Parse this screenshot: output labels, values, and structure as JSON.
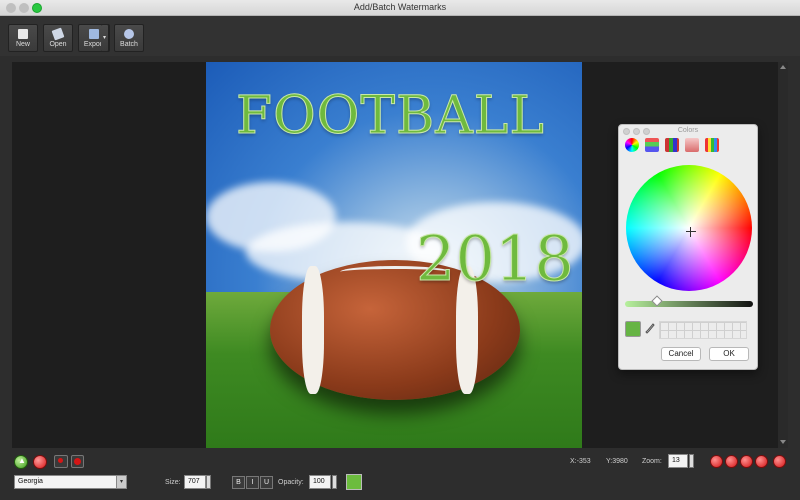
{
  "window": {
    "title": "Add/Batch Watermarks"
  },
  "toolbar": {
    "new_label": "New",
    "open_label": "Open",
    "export_label": "Export",
    "batch_label": "Batch"
  },
  "image": {
    "watermark_line1": "FOOTBALL",
    "watermark_line2": "2018"
  },
  "colors_panel": {
    "title": "Colors",
    "cancel_label": "Cancel",
    "ok_label": "OK",
    "selected_color": "#66b444"
  },
  "status": {
    "x_readout": "X:-353",
    "y_readout": "Y:3980",
    "zoom_label": "Zoom:",
    "zoom_value": "13"
  },
  "text_controls": {
    "font_value": "Georgia",
    "size_label": "Size:",
    "size_value": "707",
    "bold_label": "B",
    "italic_label": "I",
    "underline_label": "U",
    "opacity_label": "Opacity:",
    "opacity_value": "100",
    "text_color": "#6cbc3e"
  },
  "icons": [
    "add-green-icon",
    "remove-red-icon",
    "move-icon",
    "delete-icon",
    "zoom-red-icons"
  ]
}
